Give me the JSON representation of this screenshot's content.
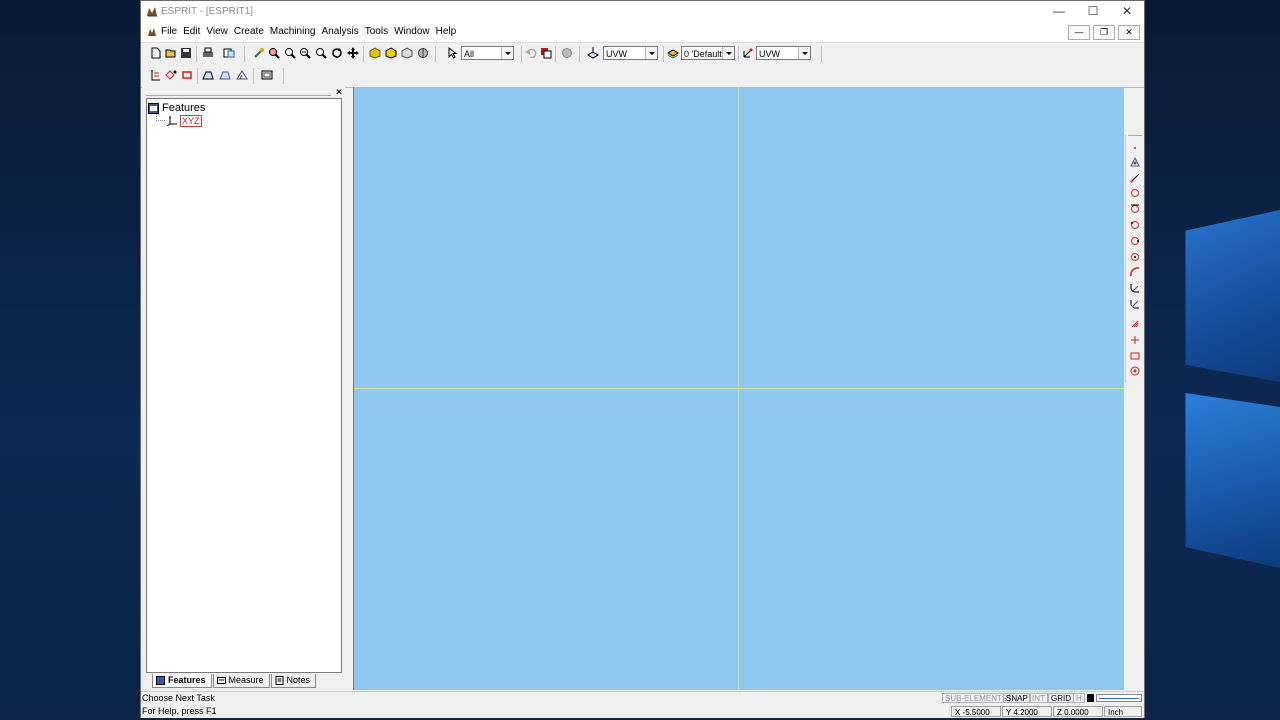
{
  "window": {
    "title": "ESPRIT - [ESPRIT1]"
  },
  "menubar": {
    "items": [
      "File",
      "Edit",
      "View",
      "Create",
      "Machining",
      "Analysis",
      "Tools",
      "Window",
      "Help"
    ]
  },
  "toolbar": {
    "selection_filter": "All",
    "work_plane": "UVW",
    "layer": "0 'Default'",
    "plane2": "UVW"
  },
  "panel": {
    "tree_root": "Features",
    "tree_child": "XYZ",
    "tabs": [
      {
        "label": "Features",
        "icon": "features-tab-icon"
      },
      {
        "label": "Measure",
        "icon": "measure-tab-icon"
      },
      {
        "label": "Notes",
        "icon": "notes-tab-icon"
      }
    ]
  },
  "status": {
    "message": "Choose Next Task",
    "help": "For Help, press F1",
    "indicators": [
      "SUB-ELEMENTS",
      "SNAP",
      "INT",
      "GRID",
      "H"
    ],
    "x": "X -5.5000",
    "y": "Y 4.2000",
    "z": "Z 0.0000",
    "units": "Inch"
  },
  "colors": {
    "viewport_bg": "#8fc7ef",
    "axis_line": "#d8e48a",
    "tree_highlight": "#c02020"
  }
}
